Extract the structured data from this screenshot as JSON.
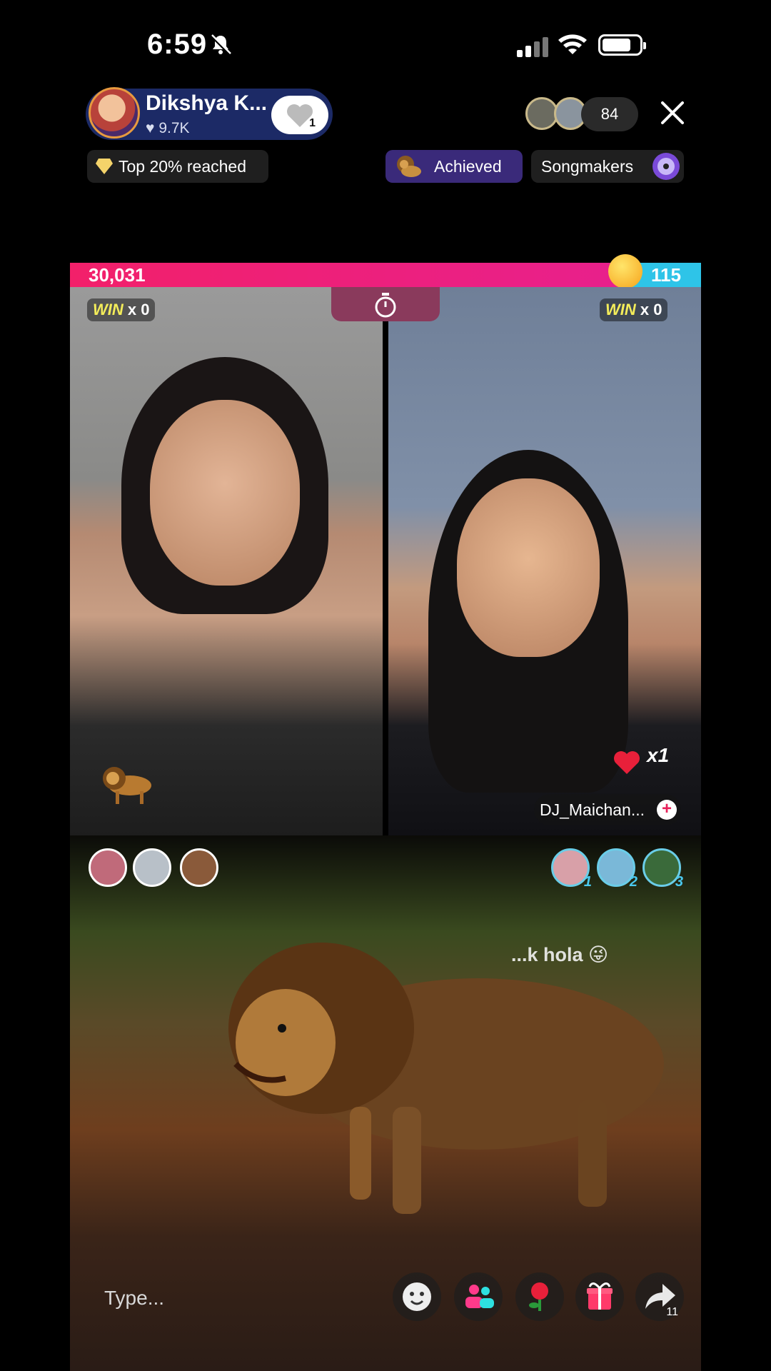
{
  "status_bar": {
    "time": "6:59"
  },
  "host": {
    "name": "Dikshya K...",
    "likes": "9.7K",
    "follow_count": "1"
  },
  "viewers": {
    "count": "84"
  },
  "chips": {
    "rank": "Top 20% reached",
    "achievement": "Achieved",
    "songmakers": "Songmakers"
  },
  "battle": {
    "score_left": "30,031",
    "score_right": "115",
    "left": {
      "win_label": "WIN",
      "win_count": "x 0"
    },
    "right": {
      "win_label": "WIN",
      "win_count": "x 0",
      "gift_multiplier": "x1",
      "username": "DJ_Maichan..."
    }
  },
  "top_gifters": {
    "ranks": [
      "1",
      "2",
      "3"
    ]
  },
  "chat": {
    "comment": "...k hola"
  },
  "composer": {
    "placeholder": "Type...",
    "share_count": "11"
  },
  "colors": {
    "left_bar": "#f2206a",
    "right_bar": "#2ec4e8",
    "host_pill": "#1c2a66",
    "achievement_chip": "#3a2a7a"
  }
}
